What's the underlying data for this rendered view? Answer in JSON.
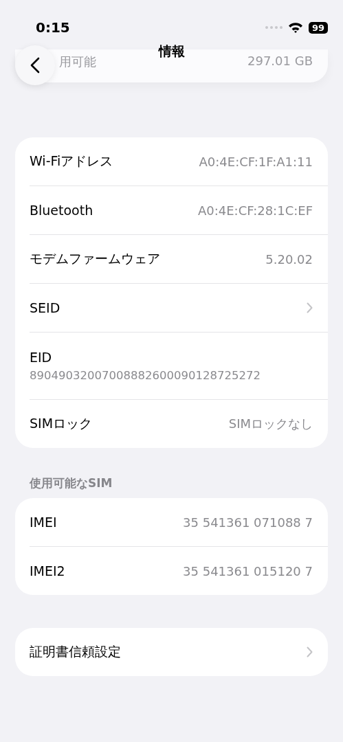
{
  "status_bar": {
    "time": "0:15",
    "battery": "99"
  },
  "nav": {
    "title": "情報"
  },
  "top_card": {
    "label": "用可能",
    "value": "297.01 GB"
  },
  "groups": [
    {
      "rows": [
        {
          "kind": "value",
          "label": "Wi-Fiアドレス",
          "value": "A0:4E:CF:1F:A1:11"
        },
        {
          "kind": "value",
          "label": "Bluetooth",
          "value": "A0:4E:CF:28:1C:EF"
        },
        {
          "kind": "value",
          "label": "モデムファームウェア",
          "value": "5.20.02"
        },
        {
          "kind": "link",
          "label": "SEID"
        },
        {
          "kind": "stacked",
          "label": "EID",
          "value": "89049032007008882600090128725272"
        },
        {
          "kind": "value",
          "label": "SIMロック",
          "value": "SIMロックなし"
        }
      ]
    },
    {
      "header": "使用可能なSIM",
      "rows": [
        {
          "kind": "value",
          "label": "IMEI",
          "value": "35 541361 071088 7"
        },
        {
          "kind": "value",
          "label": "IMEI2",
          "value": "35 541361 015120 7"
        }
      ]
    },
    {
      "rows": [
        {
          "kind": "link",
          "label": "証明書信頼設定"
        }
      ]
    }
  ]
}
